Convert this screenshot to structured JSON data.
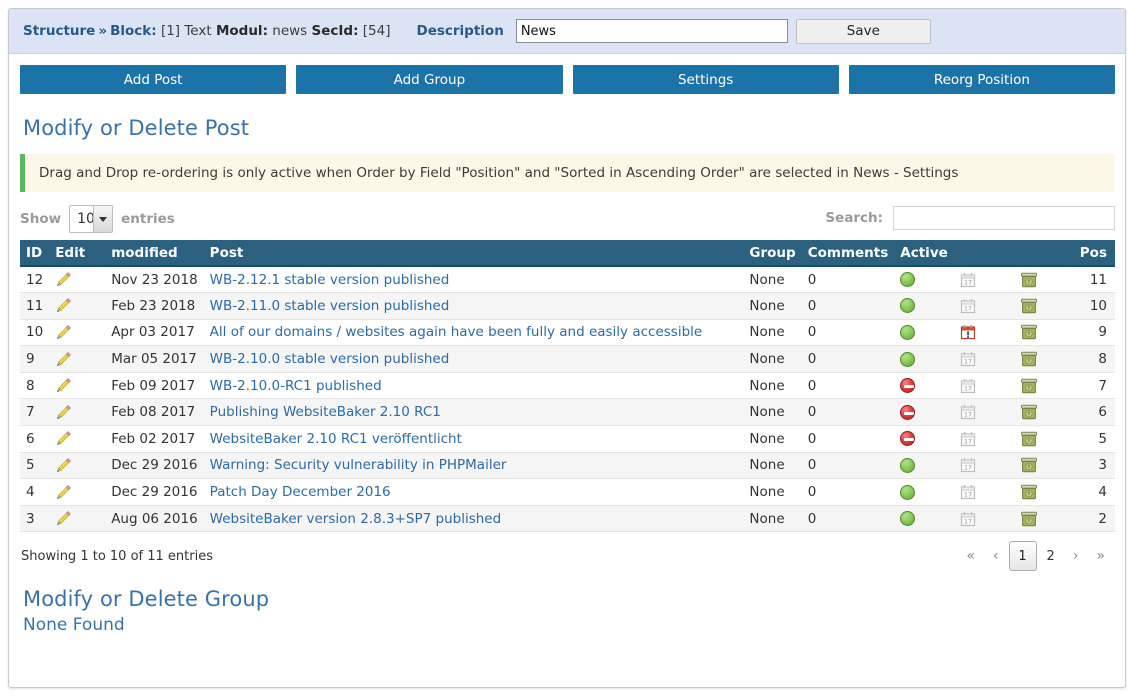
{
  "header": {
    "breadcrumb_structure": "Structure",
    "separator": "»",
    "block_label": "Block:",
    "block_value": "[1] Text",
    "modul_label": "Modul:",
    "modul_value": "news",
    "secid_label": "SecId:",
    "secid_value": "[54]",
    "description_label": "Description",
    "description_value": "News",
    "description_placeholder": "",
    "save_label": "Save"
  },
  "nav": {
    "buttons": [
      {
        "label": "Add Post",
        "name": "add-post-button"
      },
      {
        "label": "Add Group",
        "name": "add-group-button"
      },
      {
        "label": "Settings",
        "name": "settings-button"
      },
      {
        "label": "Reorg Position",
        "name": "reorg-position-button"
      }
    ]
  },
  "post_section": {
    "title": "Modify or Delete Post",
    "alert": "Drag and Drop re-ordering is only active when Order by Field \"Position\" and \"Sorted in Ascending Order\" are selected in News - Settings"
  },
  "controls": {
    "show_label": "Show",
    "length_value": "10",
    "entries_label": "entries",
    "search_label": "Search:",
    "search_value": "",
    "search_placeholder": ""
  },
  "table": {
    "columns": [
      "ID",
      "Edit",
      "modified",
      "Post",
      "Group",
      "Comments",
      "Active",
      "",
      "",
      "Pos"
    ],
    "rows": [
      {
        "id": "12",
        "modified": "Nov 23 2018",
        "post": "WB-2.12.1 stable version published",
        "group": "None",
        "comments": "0",
        "active": "green",
        "calendar": "grey",
        "pos": "11"
      },
      {
        "id": "11",
        "modified": "Feb 23 2018",
        "post": "WB-2.11.0 stable version published",
        "group": "None",
        "comments": "0",
        "active": "green",
        "calendar": "grey",
        "pos": "10"
      },
      {
        "id": "10",
        "modified": "Apr 03 2017",
        "post": "All of our domains / websites again have been fully and easily accessible",
        "group": "None",
        "comments": "0",
        "active": "green",
        "calendar": "red",
        "pos": "9"
      },
      {
        "id": "9",
        "modified": "Mar 05 2017",
        "post": "WB-2.10.0 stable version published",
        "group": "None",
        "comments": "0",
        "active": "green",
        "calendar": "grey",
        "pos": "8"
      },
      {
        "id": "8",
        "modified": "Feb 09 2017",
        "post": "WB-2.10.0-RC1 published",
        "group": "None",
        "comments": "0",
        "active": "red",
        "calendar": "grey",
        "pos": "7"
      },
      {
        "id": "7",
        "modified": "Feb 08 2017",
        "post": "Publishing WebsiteBaker 2.10 RC1",
        "group": "None",
        "comments": "0",
        "active": "red",
        "calendar": "grey",
        "pos": "6"
      },
      {
        "id": "6",
        "modified": "Feb 02 2017",
        "post": "WebsiteBaker 2.10 RC1 veröffentlicht",
        "group": "None",
        "comments": "0",
        "active": "red",
        "calendar": "grey",
        "pos": "5"
      },
      {
        "id": "5",
        "modified": "Dec 29 2016",
        "post": "Warning: Security vulnerability in PHPMailer",
        "group": "None",
        "comments": "0",
        "active": "green",
        "calendar": "grey",
        "pos": "3"
      },
      {
        "id": "4",
        "modified": "Dec 29 2016",
        "post": "Patch Day December 2016",
        "group": "None",
        "comments": "0",
        "active": "green",
        "calendar": "grey",
        "pos": "4"
      },
      {
        "id": "3",
        "modified": "Aug 06 2016",
        "post": "WebsiteBaker version 2.8.3+SP7 published",
        "group": "None",
        "comments": "0",
        "active": "green",
        "calendar": "grey",
        "pos": "2"
      }
    ]
  },
  "footer": {
    "info": "Showing 1 to 10 of 11 entries",
    "pagination": [
      {
        "label": "«",
        "name": "pagination-first",
        "current": false
      },
      {
        "label": "‹",
        "name": "pagination-previous",
        "current": false
      },
      {
        "label": "1",
        "name": "pagination-page-1",
        "current": true
      },
      {
        "label": "2",
        "name": "pagination-page-2",
        "current": false
      },
      {
        "label": "›",
        "name": "pagination-next",
        "current": false
      },
      {
        "label": "»",
        "name": "pagination-last",
        "current": false
      }
    ]
  },
  "group_section": {
    "title": "Modify or Delete Group",
    "empty_text": "None Found"
  },
  "colors": {
    "header_bar": "#dce3f5",
    "nav_button": "#1c73a7",
    "table_header": "#2b607f",
    "section_title": "#3a72a8",
    "alert_bg": "#fcf8e8",
    "alert_border": "#5cb85c",
    "link": "#2c6ba3",
    "active_green": "#8dcb5d",
    "inactive_red": "#e04343"
  }
}
